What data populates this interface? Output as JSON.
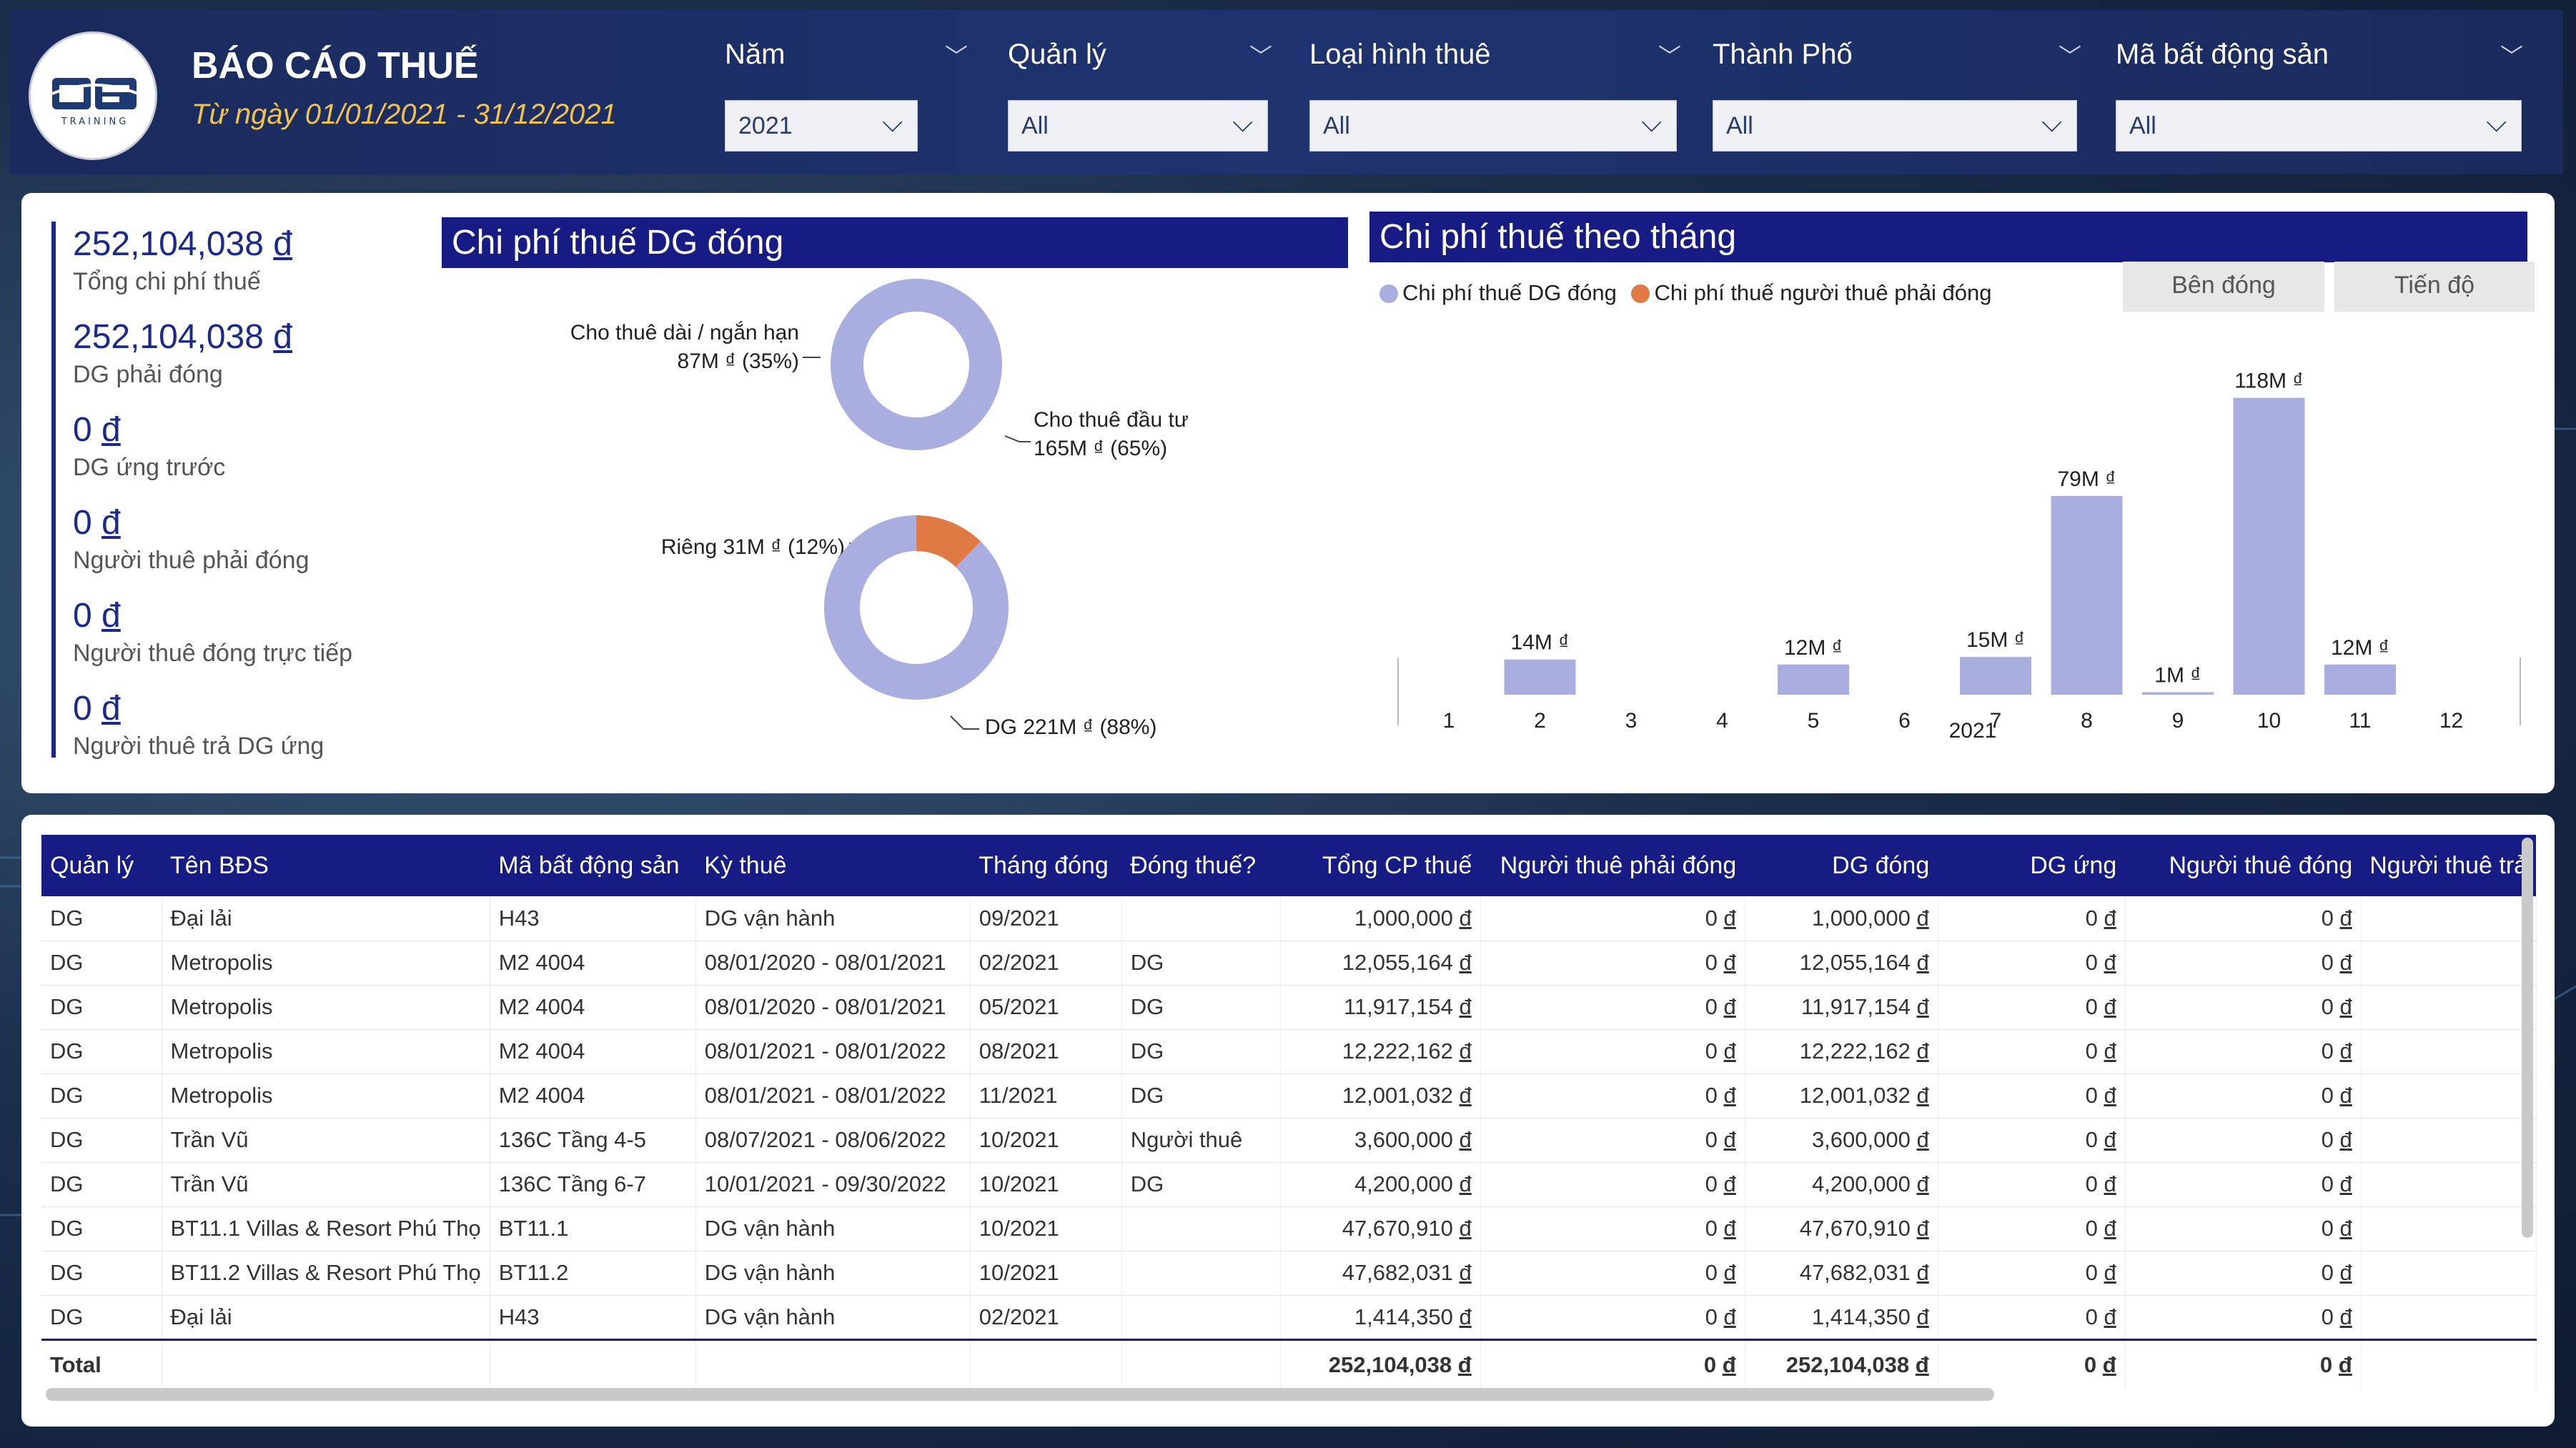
{
  "header": {
    "logo_sub": "TRAINING",
    "title": "BÁO CÁO THUẾ",
    "subtitle": "Từ ngày 01/01/2021 - 31/12/2021"
  },
  "filters": [
    {
      "label": "Năm",
      "value": "2021"
    },
    {
      "label": "Quản lý",
      "value": "All"
    },
    {
      "label": "Loại hình thuê",
      "value": "All"
    },
    {
      "label": "Thành Phố",
      "value": "All"
    },
    {
      "label": "Mã bất động sản",
      "value": "All"
    }
  ],
  "kpis": [
    {
      "value": "252,104,038",
      "currency": "đ",
      "label": "Tổng chi phí thuế"
    },
    {
      "value": "252,104,038",
      "currency": "đ",
      "label": "DG phải đóng"
    },
    {
      "value": "0",
      "currency": "đ",
      "label": "DG ứng trước"
    },
    {
      "value": "0",
      "currency": "đ",
      "label": "Người thuê phải đóng"
    },
    {
      "value": "0",
      "currency": "đ",
      "label": "Người thuê đóng trực tiếp"
    },
    {
      "value": "0",
      "currency": "đ",
      "label": "Người thuê trả DG ứng"
    }
  ],
  "donut_panel": {
    "title": "Chi phí thuế DG đóng",
    "donut1": {
      "label_a_line1": "Cho thuê dài / ngắn hạn",
      "label_a_line2": "87M ₫ (35%)",
      "label_b_line1": "Cho thuê đầu tư",
      "label_b_line2": "165M ₫ (65%)"
    },
    "donut2": {
      "label_a": "Riêng 31M ₫ (12%)",
      "label_b": "DG 221M ₫ (88%)"
    }
  },
  "monthly_panel": {
    "title": "Chi phí thuế theo tháng",
    "legend": [
      {
        "name": "Chi phí thuế DG đóng",
        "color": "#a9addf"
      },
      {
        "name": "Chi phí thuế người thuê phải đóng",
        "color": "#e07a45"
      }
    ],
    "buttons": [
      "Bên đóng",
      "Tiến độ"
    ],
    "year_label": "2021"
  },
  "chart_data": [
    {
      "type": "pie",
      "title": "",
      "categories": [
        "Cho thuê dài / ngắn hạn",
        "Cho thuê đầu tư"
      ],
      "values": [
        87,
        165
      ],
      "unit": "M ₫",
      "colors": [
        "#a9addf",
        "#a9addf"
      ]
    },
    {
      "type": "pie",
      "title": "",
      "categories": [
        "Riêng",
        "DG"
      ],
      "values": [
        31,
        221
      ],
      "unit": "M ₫",
      "colors": [
        "#e07a45",
        "#a9addf"
      ]
    },
    {
      "type": "bar",
      "title": "Chi phí thuế theo tháng",
      "categories": [
        "1",
        "2",
        "3",
        "4",
        "5",
        "6",
        "7",
        "8",
        "9",
        "10",
        "11",
        "12"
      ],
      "series": [
        {
          "name": "Chi phí thuế DG đóng",
          "values": [
            0,
            14,
            0,
            0,
            12,
            0,
            15,
            79,
            1,
            118,
            12,
            0
          ]
        },
        {
          "name": "Chi phí thuế người thuê phải đóng",
          "values": [
            0,
            0,
            0,
            0,
            0,
            0,
            0,
            0,
            0,
            0,
            0,
            0
          ]
        }
      ],
      "data_labels": [
        "",
        "14M ₫",
        "",
        "",
        "12M ₫",
        "",
        "15M ₫",
        "79M ₫",
        "1M ₫",
        "118M ₫",
        "12M ₫",
        ""
      ],
      "xlabel": "2021",
      "ylim": [
        0,
        125
      ]
    }
  ],
  "table": {
    "columns": [
      "Quản lý",
      "Tên BĐS",
      "Mã bất động sản",
      "Kỳ thuê",
      "Tháng đóng",
      "Đóng thuế?",
      "Tổng CP thuế",
      "Người thuê phải đóng",
      "DG đóng",
      "DG ứng",
      "Người thuê đóng",
      "Người thuê trả"
    ],
    "rows": [
      [
        "DG",
        "Đại lải",
        "H43",
        "DG vận hành",
        "09/2021",
        "",
        "1,000,000",
        "0",
        "1,000,000",
        "0",
        "0",
        ""
      ],
      [
        "DG",
        "Metropolis",
        "M2 4004",
        "08/01/2020 - 08/01/2021",
        "02/2021",
        "DG",
        "12,055,164",
        "0",
        "12,055,164",
        "0",
        "0",
        ""
      ],
      [
        "DG",
        "Metropolis",
        "M2 4004",
        "08/01/2020 - 08/01/2021",
        "05/2021",
        "DG",
        "11,917,154",
        "0",
        "11,917,154",
        "0",
        "0",
        ""
      ],
      [
        "DG",
        "Metropolis",
        "M2 4004",
        "08/01/2021 - 08/01/2022",
        "08/2021",
        "DG",
        "12,222,162",
        "0",
        "12,222,162",
        "0",
        "0",
        ""
      ],
      [
        "DG",
        "Metropolis",
        "M2 4004",
        "08/01/2021 - 08/01/2022",
        "11/2021",
        "DG",
        "12,001,032",
        "0",
        "12,001,032",
        "0",
        "0",
        ""
      ],
      [
        "DG",
        "Trần Vũ",
        "136C Tầng 4-5",
        "08/07/2021 - 08/06/2022",
        "10/2021",
        "Người thuê",
        "3,600,000",
        "0",
        "3,600,000",
        "0",
        "0",
        ""
      ],
      [
        "DG",
        "Trần Vũ",
        "136C Tầng 6-7",
        "10/01/2021 - 09/30/2022",
        "10/2021",
        "DG",
        "4,200,000",
        "0",
        "4,200,000",
        "0",
        "0",
        ""
      ],
      [
        "DG",
        "BT11.1 Villas & Resort Phú Thọ",
        "BT11.1",
        "DG vận hành",
        "10/2021",
        "",
        "47,670,910",
        "0",
        "47,670,910",
        "0",
        "0",
        ""
      ],
      [
        "DG",
        "BT11.2 Villas & Resort Phú Thọ",
        "BT11.2",
        "DG vận hành",
        "10/2021",
        "",
        "47,682,031",
        "0",
        "47,682,031",
        "0",
        "0",
        ""
      ],
      [
        "DG",
        "Đại lải",
        "H43",
        "DG vận hành",
        "02/2021",
        "",
        "1,414,350",
        "0",
        "1,414,350",
        "0",
        "0",
        ""
      ]
    ],
    "total_label": "Total",
    "totals": [
      "252,104,038",
      "0",
      "252,104,038",
      "0",
      "0"
    ],
    "currency": "đ"
  }
}
